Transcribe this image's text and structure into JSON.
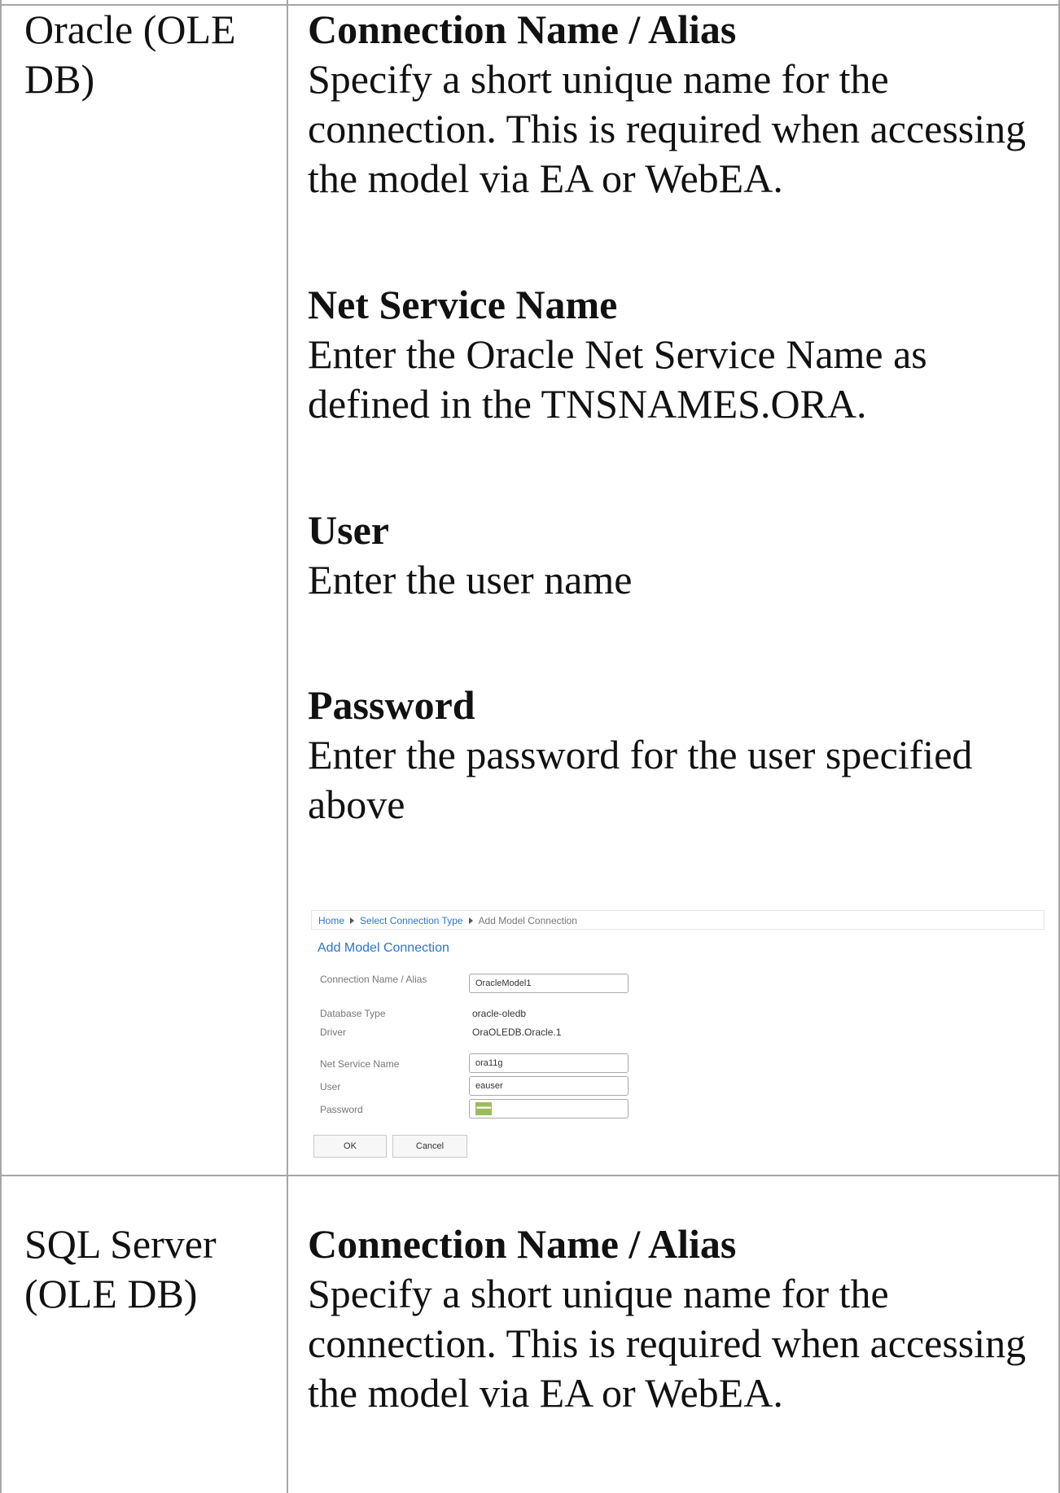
{
  "rows": [
    {
      "label": "Oracle (OLE DB)",
      "fields": [
        {
          "title": "Connection Name / Alias",
          "desc": "Specify a short unique name for the connection. This is required when accessing the model via EA or WebEA."
        },
        {
          "title": "Net Service Name",
          "desc": "Enter the Oracle Net Service Name as defined in the TNSNAMES.ORA."
        },
        {
          "title": "User",
          "desc": "Enter the user name"
        },
        {
          "title": "Password",
          "desc": "Enter the password for the user specified above"
        }
      ],
      "screenshot": {
        "breadcrumb": [
          "Home",
          "Select Connection Type",
          "Add Model Connection"
        ],
        "heading": "Add Model Connection",
        "connection_name_label": "Connection Name / Alias",
        "connection_name_value": "OracleModel1",
        "database_type_label": "Database Type",
        "database_type_value": "oracle-oledb",
        "driver_label": "Driver",
        "driver_value": "OraOLEDB.Oracle.1",
        "net_service_label": "Net Service Name",
        "net_service_value": "ora11g",
        "user_label": "User",
        "user_value": "eauser",
        "password_label": "Password",
        "password_value": "•••••••",
        "ok_label": "OK",
        "cancel_label": "Cancel"
      }
    },
    {
      "label": "SQL Server (OLE DB)",
      "fields": [
        {
          "title": "Connection Name / Alias",
          "desc": "Specify a short unique name for the connection. This is required when accessing the model via EA or WebEA."
        }
      ]
    }
  ]
}
